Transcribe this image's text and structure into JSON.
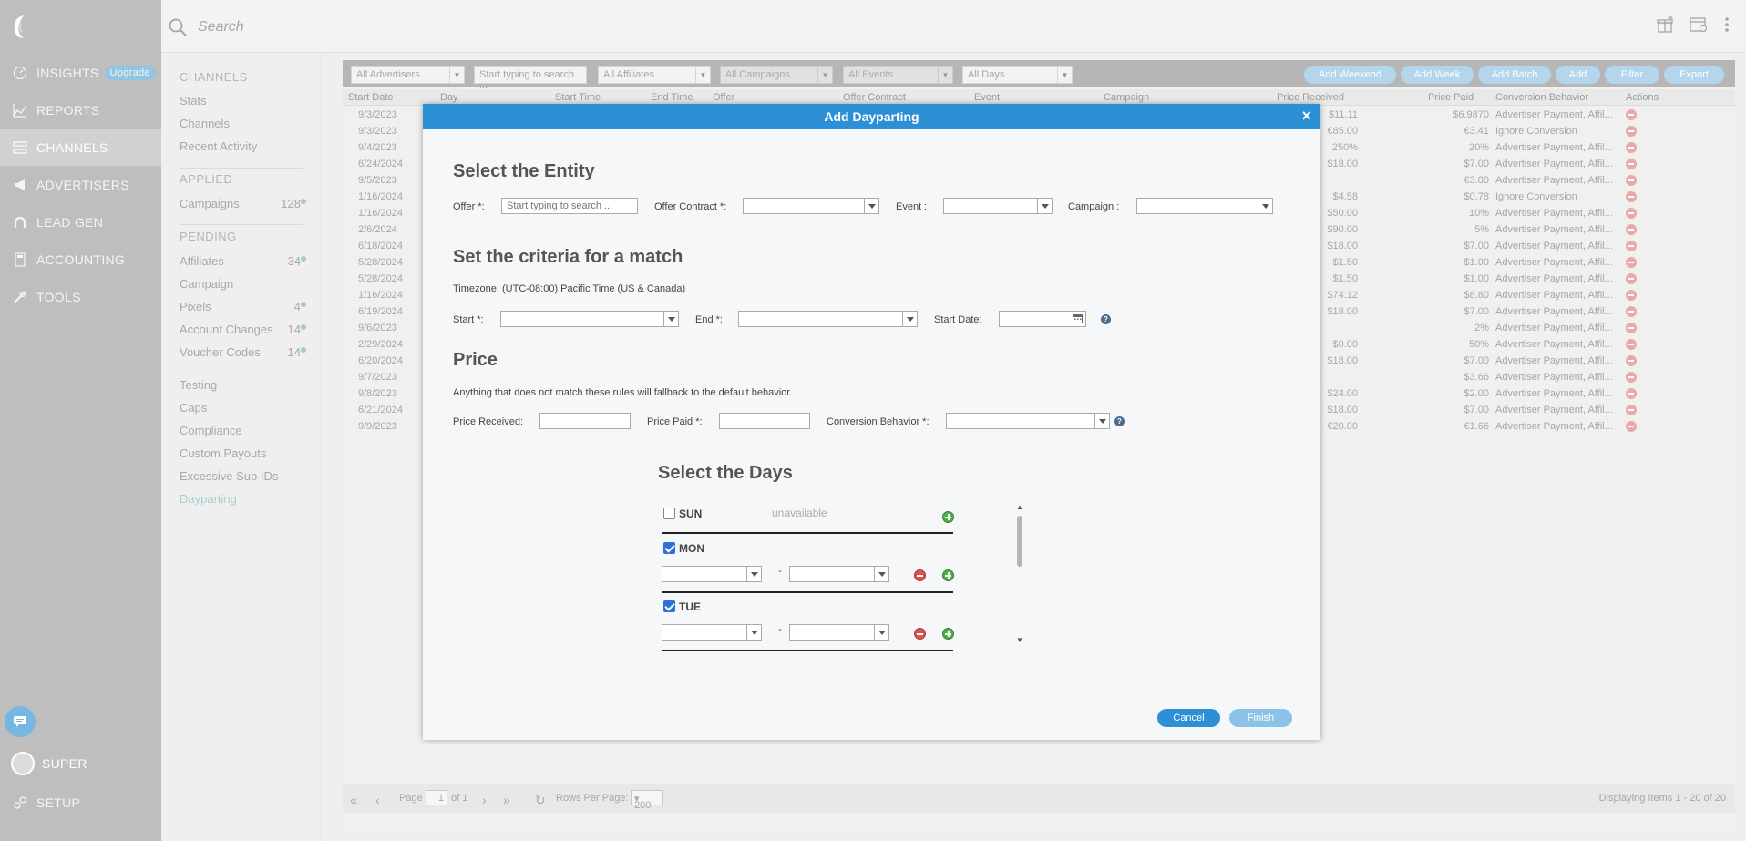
{
  "nav": {
    "items": [
      {
        "label": "INSIGHTS",
        "icon": "gauge-icon"
      },
      {
        "label": "REPORTS",
        "icon": "chart-icon"
      },
      {
        "label": "CHANNELS",
        "icon": "channels-icon"
      },
      {
        "label": "ADVERTISERS",
        "icon": "megaphone-icon"
      },
      {
        "label": "LEAD GEN",
        "icon": "magnet-icon"
      },
      {
        "label": "ACCOUNTING",
        "icon": "calculator-icon"
      },
      {
        "label": "TOOLS",
        "icon": "tools-icon"
      }
    ],
    "upgrade": "Upgrade",
    "user": "SUPER",
    "setup": "SETUP"
  },
  "search": {
    "placeholder": "Search"
  },
  "subnav": {
    "channels_title": "CHANNELS",
    "stats": "Stats",
    "channels": "Channels",
    "recent": "Recent Activity",
    "applied_title": "APPLIED",
    "campaigns": "Campaigns",
    "campaigns_count": "128",
    "pending_title": "PENDING",
    "affiliates": "Affiliates",
    "affiliates_count": "34",
    "campaign": "Campaign",
    "pixels": "Pixels",
    "pixels_count": "4",
    "account_changes": "Account Changes",
    "account_changes_count": "14",
    "voucher_codes": "Voucher Codes",
    "voucher_codes_count": "14",
    "testing": "Testing",
    "caps": "Caps",
    "compliance": "Compliance",
    "custom_payouts": "Custom Payouts",
    "excessive": "Excessive Sub IDs",
    "dayparting": "Dayparting"
  },
  "toolbar": {
    "filters": [
      "All Advertisers",
      "Start typing to search ...",
      "All Affiliates",
      "All Campaigns",
      "All Events",
      "All Days"
    ],
    "buttons": [
      "Add Weekend",
      "Add Week",
      "Add Batch",
      "Add",
      "Filter",
      "Export"
    ]
  },
  "grid": {
    "headers": [
      "Start Date",
      "Day",
      "Start Time",
      "End Time",
      "Offer",
      "Offer Contract",
      "Event",
      "Campaign",
      "Price Received",
      "Price Paid",
      "Conversion Behavior",
      "Actions"
    ],
    "rows": [
      {
        "date": "9/3/2023",
        "received": "$11.11",
        "paid": "$6.9870",
        "behavior": "Advertiser Payment, Affil..."
      },
      {
        "date": "9/3/2023",
        "received": "€85.00",
        "paid": "€3.41",
        "behavior": "Ignore Conversion"
      },
      {
        "date": "9/4/2023",
        "received": "250%",
        "paid": "20%",
        "behavior": "Advertiser Payment, Affil..."
      },
      {
        "date": "6/24/2024",
        "received": "$18.00",
        "paid": "$7.00",
        "behavior": "Advertiser Payment, Affil..."
      },
      {
        "date": "9/5/2023",
        "received": "",
        "paid": "€3.00",
        "behavior": "Advertiser Payment, Affil..."
      },
      {
        "date": "1/16/2024",
        "received": "$4.58",
        "paid": "$0.78",
        "behavior": "Ignore Conversion"
      },
      {
        "date": "1/16/2024",
        "received": "$50.00",
        "paid": "10%",
        "behavior": "Advertiser Payment, Affil..."
      },
      {
        "date": "2/6/2024",
        "received": "$90.00",
        "paid": "5%",
        "behavior": "Advertiser Payment, Affil..."
      },
      {
        "date": "6/18/2024",
        "received": "$18.00",
        "paid": "$7.00",
        "behavior": "Advertiser Payment, Affil..."
      },
      {
        "date": "5/28/2024",
        "received": "$1.50",
        "paid": "$1.00",
        "behavior": "Advertiser Payment, Affil..."
      },
      {
        "date": "5/28/2024",
        "received": "$1.50",
        "paid": "$1.00",
        "behavior": "Advertiser Payment, Affil..."
      },
      {
        "date": "1/16/2024",
        "received": "$74.12",
        "paid": "$8.80",
        "behavior": "Advertiser Payment, Affil..."
      },
      {
        "date": "6/19/2024",
        "received": "$18.00",
        "paid": "$7.00",
        "behavior": "Advertiser Payment, Affil..."
      },
      {
        "date": "9/6/2023",
        "received": "",
        "paid": "2%",
        "behavior": "Advertiser Payment, Affil..."
      },
      {
        "date": "2/29/2024",
        "received": "$0.00",
        "paid": "50%",
        "behavior": "Advertiser Payment, Affil..."
      },
      {
        "date": "6/20/2024",
        "received": "$18.00",
        "paid": "$7.00",
        "behavior": "Advertiser Payment, Affil..."
      },
      {
        "date": "9/7/2023",
        "received": "",
        "paid": "$3.66",
        "behavior": "Advertiser Payment, Affil..."
      },
      {
        "date": "9/8/2023",
        "received": "$24.00",
        "paid": "$2.00",
        "behavior": "Advertiser Payment, Affil..."
      },
      {
        "date": "6/21/2024",
        "received": "$18.00",
        "paid": "$7.00",
        "behavior": "Advertiser Payment, Affil..."
      },
      {
        "date": "9/9/2023",
        "received": "€20.00",
        "paid": "€1.66",
        "behavior": "Advertiser Payment, Affil..."
      }
    ],
    "footer": {
      "page_label": "Page",
      "page_value": "1",
      "of_label": "of 1",
      "rows_label": "Rows Per Page:",
      "rows_value": "200",
      "displaying": "Displaying Items 1 - 20 of 20"
    }
  },
  "dialog": {
    "title": "Add Dayparting",
    "close": "×",
    "entity_heading": "Select the Entity",
    "offer_label": "Offer *:",
    "offer_placeholder": "Start typing to search ...",
    "offer_contract_label": "Offer Contract *:",
    "event_label": "Event :",
    "campaign_label": "Campaign :",
    "criteria_heading": "Set the criteria for a match",
    "timezone": "Timezone: (UTC-08:00) Pacific Time (US & Canada)",
    "start_label": "Start *:",
    "end_label": "End *:",
    "start_date_label": "Start Date:",
    "price_heading": "Price",
    "price_note": "Anything that does not match these rules will fallback to the default behavior.",
    "price_received_label": "Price Received:",
    "price_paid_label": "Price Paid *:",
    "conversion_label": "Conversion Behavior *:",
    "days_heading": "Select the Days",
    "days": [
      {
        "name": "SUN",
        "checked": false,
        "status": "unavailable"
      },
      {
        "name": "MON",
        "checked": true
      },
      {
        "name": "TUE",
        "checked": true
      }
    ],
    "dash": "-",
    "cancel": "Cancel",
    "finish": "Finish"
  },
  "colors": {
    "accent": "#2d8fd5",
    "nav_bg": "#9c9c9c",
    "link_selected": "#74b6b6"
  }
}
